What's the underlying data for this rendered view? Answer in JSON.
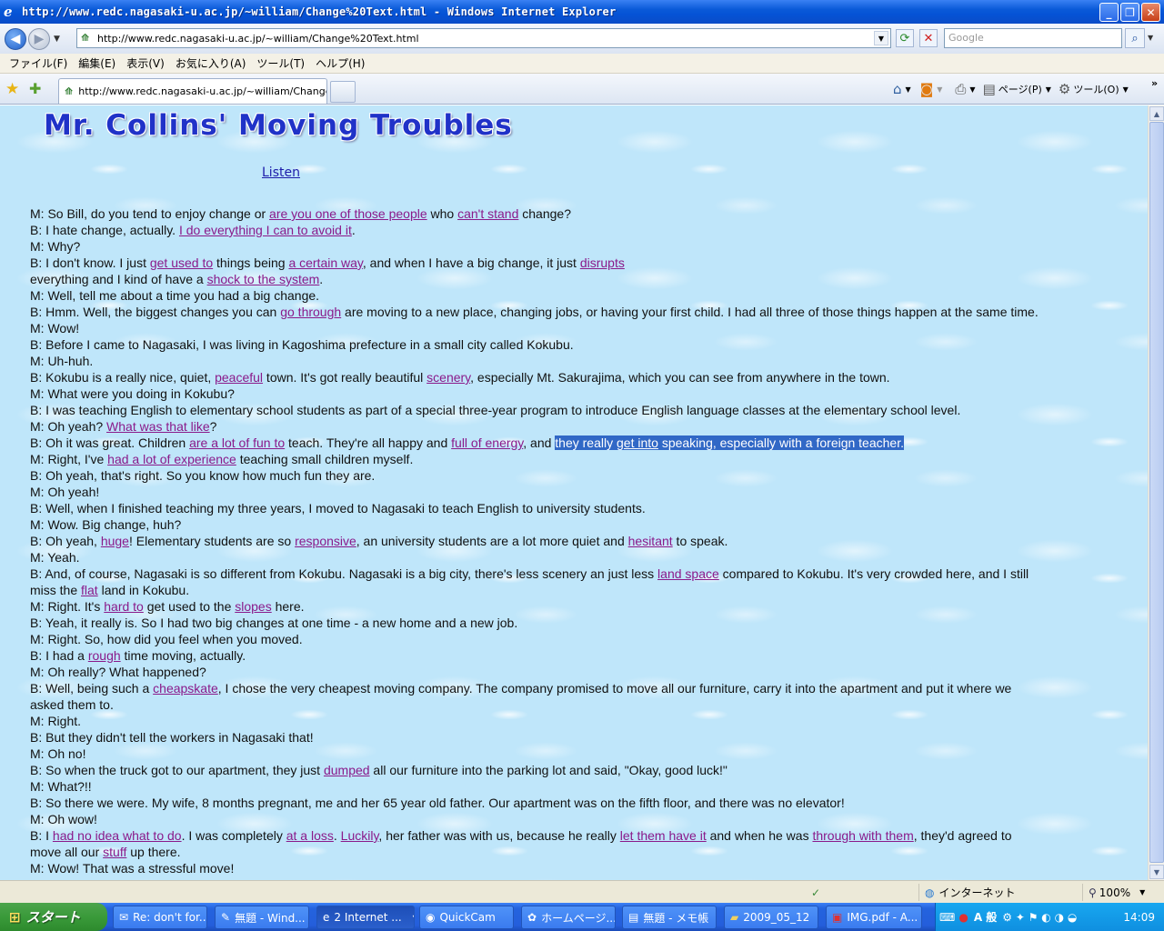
{
  "window": {
    "title": "http://www.redc.nagasaki-u.ac.jp/~william/Change%20Text.html - Windows Internet Explorer"
  },
  "address": {
    "url": "http://www.redc.nagasaki-u.ac.jp/~william/Change%20Text.html",
    "search_placeholder": "Google"
  },
  "menu": [
    "ファイル(F)",
    "編集(E)",
    "表示(V)",
    "お気に入り(A)",
    "ツール(T)",
    "ヘルプ(H)"
  ],
  "tab": {
    "label": "http://www.redc.nagasaki-u.ac.jp/~william/Change%..."
  },
  "commandbar": {
    "page_label": "ページ(P)",
    "tools_label": "ツール(O)"
  },
  "page": {
    "title": "Mr. Collins' Moving Troubles",
    "listen_link": "Listen",
    "lines": [
      [
        [
          "M: So Bill, do you tend to enjoy change or ",
          0
        ],
        [
          "are you one of those people",
          1
        ],
        [
          " who ",
          0
        ],
        [
          "can't stand",
          1
        ],
        [
          " change?",
          0
        ]
      ],
      [
        [
          "B: I hate change, actually. ",
          0
        ],
        [
          "I do everything I can to avoid it",
          1
        ],
        [
          ".",
          0
        ]
      ],
      [
        [
          "M: Why?",
          0
        ]
      ],
      [
        [
          "B: I don't know. I just ",
          0
        ],
        [
          "get used to",
          1
        ],
        [
          " things being ",
          0
        ],
        [
          "a certain way",
          1
        ],
        [
          ", and when I have a big change, it just ",
          0
        ],
        [
          "disrupts",
          1
        ]
      ],
      [
        [
          "everything and I kind of have a ",
          0
        ],
        [
          "shock to the system",
          1
        ],
        [
          ".",
          0
        ]
      ],
      [
        [
          "M: Well, tell me about a time you had a big change.",
          0
        ]
      ],
      [
        [
          "B: Hmm. Well, the biggest changes you can ",
          0
        ],
        [
          "go through",
          1
        ],
        [
          " are moving to a new place, changing jobs, or having your first child. I had all three of those things happen at the same time.",
          0
        ]
      ],
      [
        [
          "M: Wow!",
          0
        ]
      ],
      [
        [
          "B: Before I came to Nagasaki, I was living in Kagoshima prefecture in a small city called Kokubu.",
          0
        ]
      ],
      [
        [
          "M: Uh-huh.",
          0
        ]
      ],
      [
        [
          "B: Kokubu is a really nice, quiet, ",
          0
        ],
        [
          "peaceful",
          1
        ],
        [
          " town. It's got really beautiful ",
          0
        ],
        [
          "scenery",
          1
        ],
        [
          ", especially Mt. Sakurajima, which you can see from anywhere in the town.",
          0
        ]
      ],
      [
        [
          "M: What were you doing in Kokubu?",
          0
        ]
      ],
      [
        [
          "B: I was teaching English to elementary school students as part of a special three-year program to introduce English language classes at the elementary school level.",
          0
        ]
      ],
      [
        [
          "M: Oh yeah? ",
          0
        ],
        [
          "What was that like",
          1
        ],
        [
          "?",
          0
        ]
      ],
      [
        [
          "B: Oh it was great. Children ",
          0
        ],
        [
          "are a lot of fun to",
          1
        ],
        [
          " teach. They're all happy and ",
          0
        ],
        [
          "full of energy",
          1
        ],
        [
          ", and ",
          0
        ],
        [
          "they really ",
          2
        ],
        [
          "get into",
          3
        ],
        [
          " speaking, especially with a foreign teacher. ",
          2
        ]
      ],
      [
        [
          "M: Right, I've ",
          0
        ],
        [
          "had a lot of experience",
          1
        ],
        [
          " teaching small children myself.",
          0
        ]
      ],
      [
        [
          "B: Oh yeah, that's right. So you know how much fun they are.",
          0
        ]
      ],
      [
        [
          "M: Oh yeah!",
          0
        ]
      ],
      [
        [
          "B: Well, when I finished teaching my three years, I moved to Nagasaki to teach English to university students.",
          0
        ]
      ],
      [
        [
          "M: Wow. Big change, huh?",
          0
        ]
      ],
      [
        [
          "B: Oh yeah, ",
          0
        ],
        [
          "huge",
          1
        ],
        [
          "! Elementary students are so ",
          0
        ],
        [
          "responsive",
          1
        ],
        [
          ", an university students are a lot more quiet and ",
          0
        ],
        [
          "hesitant",
          1
        ],
        [
          " to speak.",
          0
        ]
      ],
      [
        [
          "M: Yeah.",
          0
        ]
      ],
      [
        [
          "B: And, of course, Nagasaki is so different from Kokubu. Nagasaki is a big city, there's less scenery an just less ",
          0
        ],
        [
          "land space",
          1
        ],
        [
          " compared to Kokubu. It's very crowded here, and I still",
          0
        ]
      ],
      [
        [
          "miss the ",
          0
        ],
        [
          "flat",
          1
        ],
        [
          " land in Kokubu.",
          0
        ]
      ],
      [
        [
          "M: Right. It's ",
          0
        ],
        [
          "hard to",
          1
        ],
        [
          " get used to the ",
          0
        ],
        [
          "slopes",
          1
        ],
        [
          " here.",
          0
        ]
      ],
      [
        [
          "B: Yeah, it really is. So I had two big changes at one time - a new home and a new job.",
          0
        ]
      ],
      [
        [
          "M: Right. So, how did you feel when you moved.",
          0
        ]
      ],
      [
        [
          "B: I had a ",
          0
        ],
        [
          "rough",
          1
        ],
        [
          " time moving, actually.",
          0
        ]
      ],
      [
        [
          "M: Oh really? What happened?",
          0
        ]
      ],
      [
        [
          "B: Well, being such a ",
          0
        ],
        [
          "cheapskate",
          1
        ],
        [
          ", I chose the very cheapest moving company. The company promised to move all our furniture, carry it into the apartment and put it where we",
          0
        ]
      ],
      [
        [
          "asked them to.",
          0
        ]
      ],
      [
        [
          "M: Right.",
          0
        ]
      ],
      [
        [
          "B: But they didn't tell the workers in Nagasaki that!",
          0
        ]
      ],
      [
        [
          "M: Oh no!",
          0
        ]
      ],
      [
        [
          "B: So when the truck got to our apartment, they just ",
          0
        ],
        [
          "dumped",
          1
        ],
        [
          " all our furniture into the parking lot and said, \"Okay, good luck!\"",
          0
        ]
      ],
      [
        [
          "M: What?!!",
          0
        ]
      ],
      [
        [
          "B: So there we were. My wife, 8 months pregnant, me and her 65 year old father. Our apartment was on the fifth floor, and there was no elevator!",
          0
        ]
      ],
      [
        [
          "M: Oh wow!",
          0
        ]
      ],
      [
        [
          "B: I ",
          0
        ],
        [
          "had no idea what to do",
          1
        ],
        [
          ". I was completely ",
          0
        ],
        [
          "at a loss",
          1
        ],
        [
          ". ",
          0
        ],
        [
          "Luckily",
          1
        ],
        [
          ", her father was with us, because he really ",
          0
        ],
        [
          "let them have it",
          1
        ],
        [
          " and when he was ",
          0
        ],
        [
          "through with them",
          1
        ],
        [
          ", they'd agreed to",
          0
        ]
      ],
      [
        [
          "move all our ",
          0
        ],
        [
          "stuff",
          1
        ],
        [
          " up there.",
          0
        ]
      ],
      [
        [
          "M: Wow! That was a stressful move!",
          0
        ]
      ]
    ]
  },
  "status": {
    "zone": "インターネット",
    "zoom": "100%"
  },
  "taskbar": {
    "start": "スタート",
    "items": [
      "Re: don't for...",
      "無題 - Wind...",
      "2 Internet ...",
      "QuickCam",
      "ホームページ...",
      "無題 - メモ帳",
      "2009_05_12",
      "IMG.pdf - A..."
    ],
    "clock": "14:09",
    "ime": "A 般"
  }
}
